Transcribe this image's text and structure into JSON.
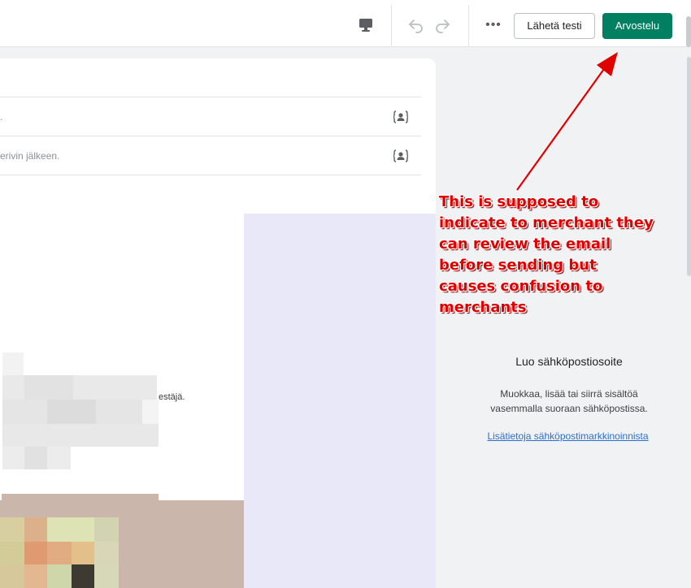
{
  "toolbar": {
    "desktop_preview_icon": "desktop-icon",
    "undo_icon": "undo-icon",
    "redo_icon": "redo-icon",
    "more_label": "•••",
    "send_test_label": "Lähetä testi",
    "review_label": "Arvostelu",
    "primary_color": "#008060"
  },
  "editor": {
    "row1_text": ".",
    "row2_text": "erivin jälkeen.",
    "personalize_icon": "personalize-icon",
    "preview_text": "estäjä."
  },
  "right_panel": {
    "title": "Luo sähköpostiosoite",
    "description": "Muokkaa, lisää tai siirrä sisältöä vasemmalla suoraan sähköpostissa.",
    "link": "Lisätietoja sähköpostimarkkinoinnista"
  },
  "annotation": {
    "text": "This is supposed to\nindicate to merchant they\ncan review the email\nbefore sending but\ncauses confusion to\nmerchants",
    "color": "#e00000"
  }
}
